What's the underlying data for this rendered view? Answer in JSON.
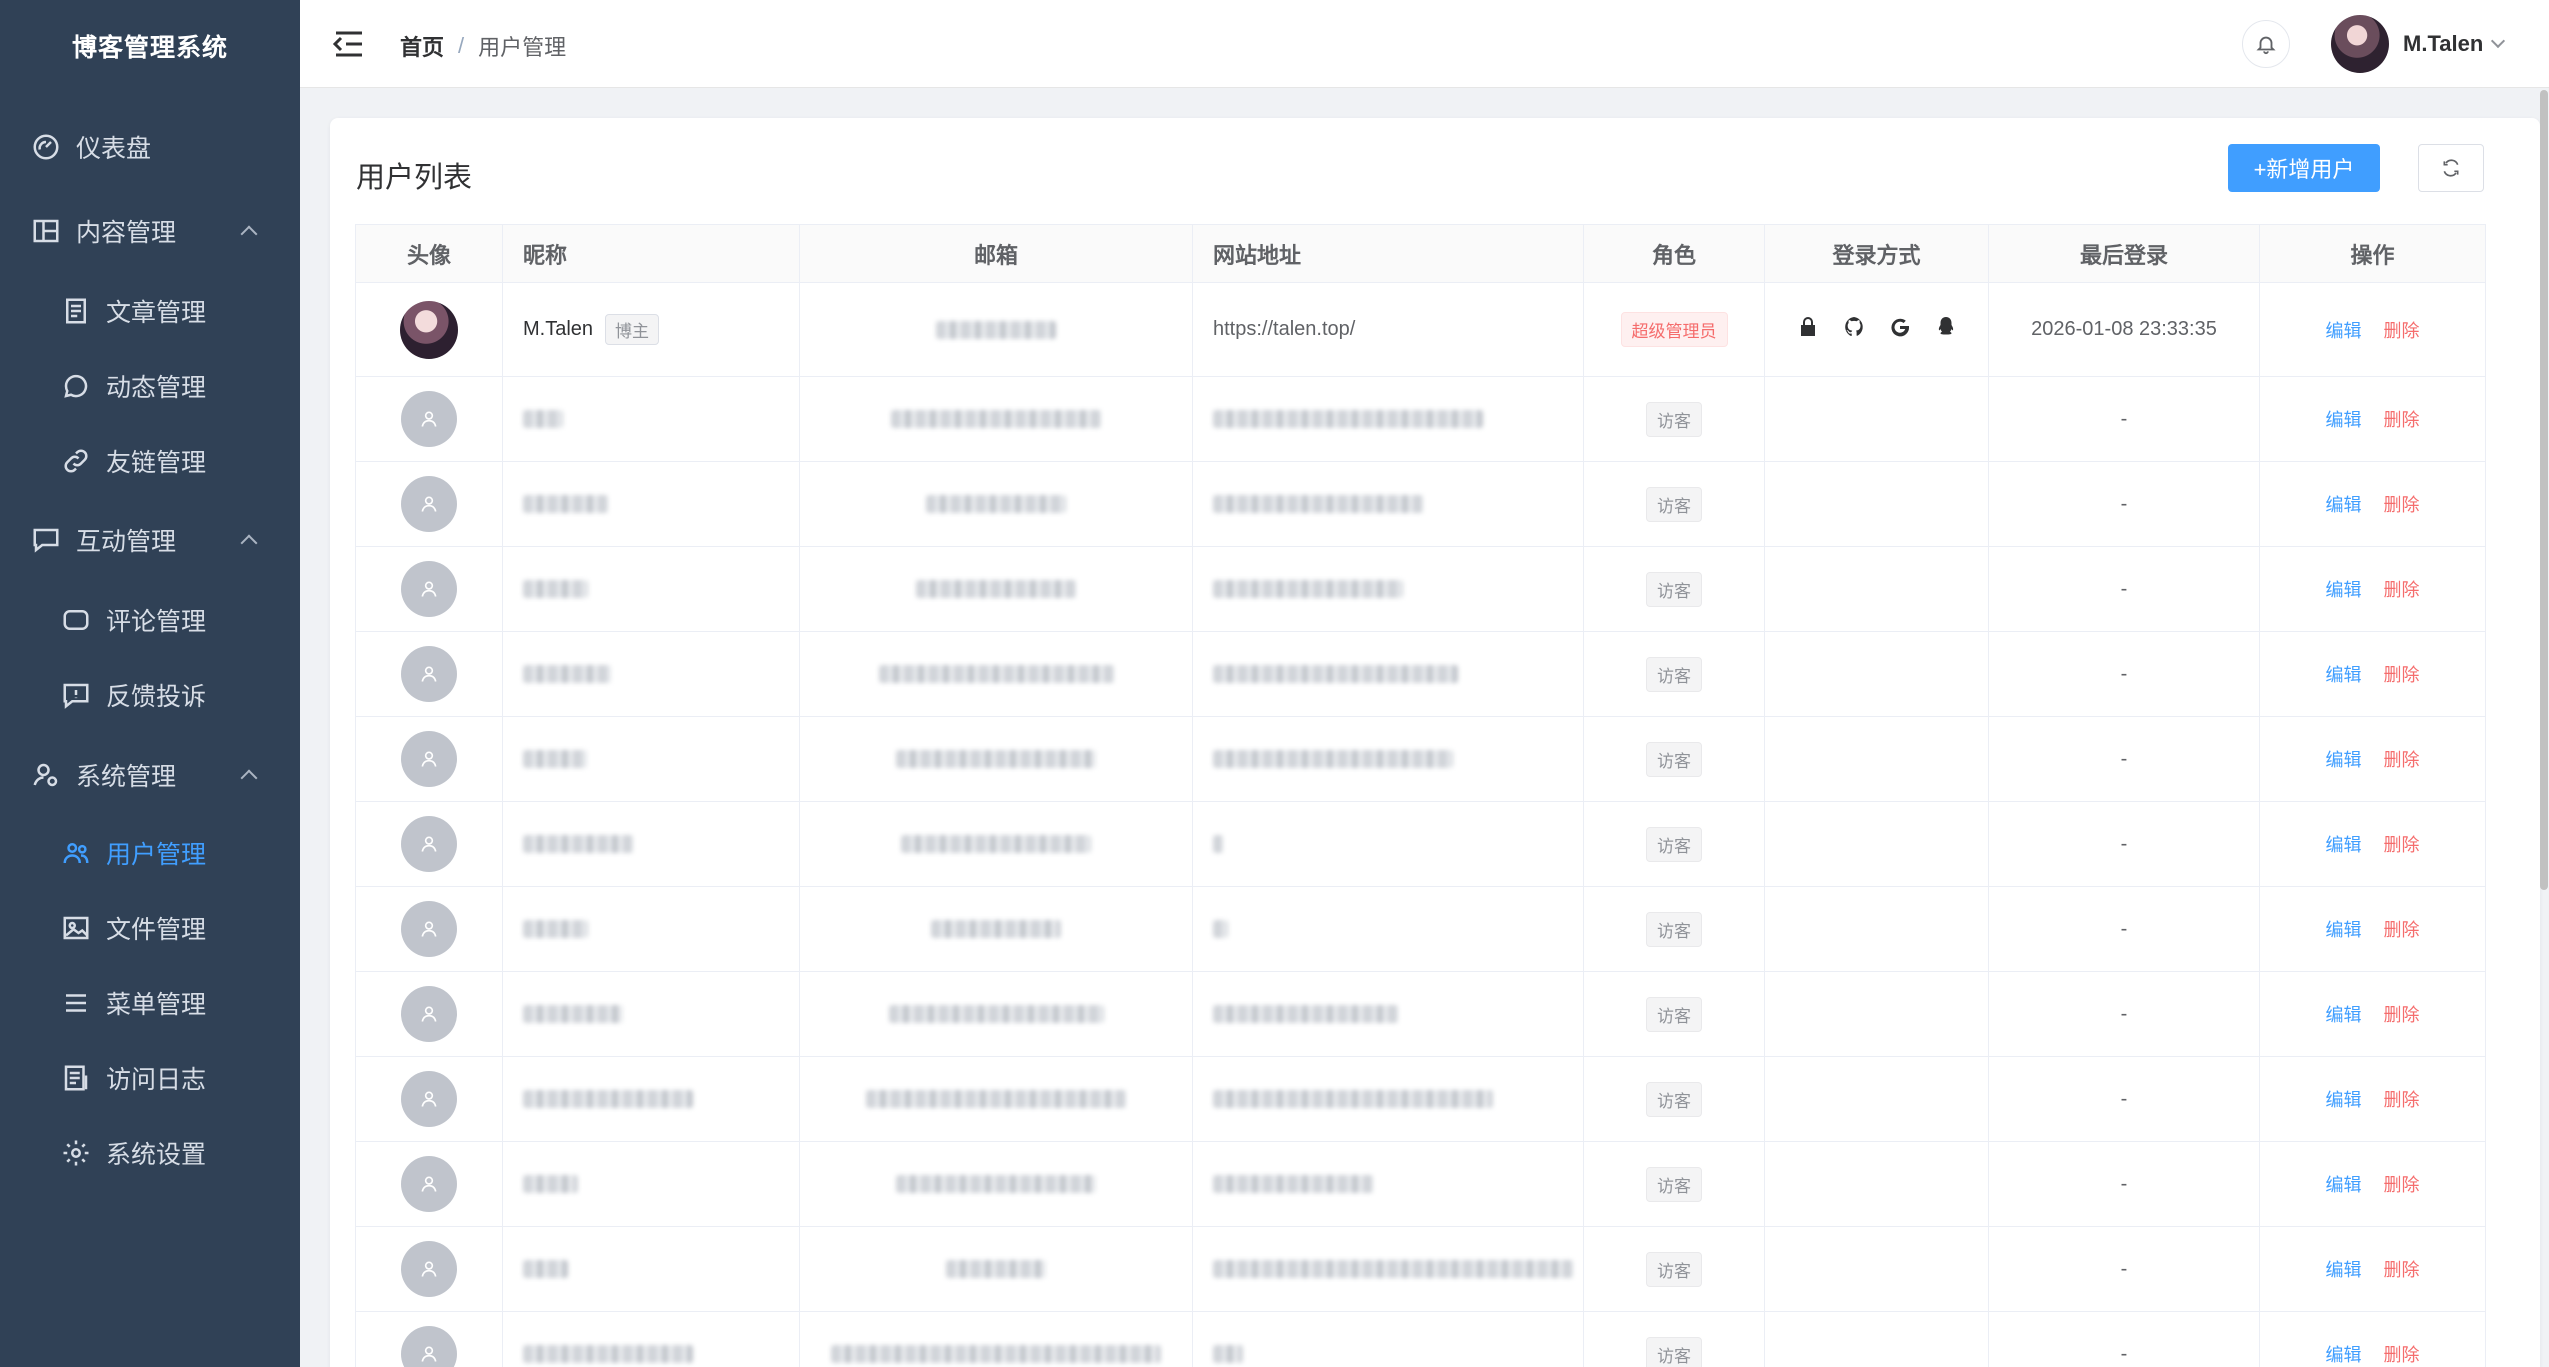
{
  "app": {
    "title": "博客管理系统"
  },
  "menu": {
    "dashboard": "仪表盘",
    "content": "内容管理",
    "articles": "文章管理",
    "moments": "动态管理",
    "friends": "友链管理",
    "interaction": "互动管理",
    "comments": "评论管理",
    "feedback": "反馈投诉",
    "system": "系统管理",
    "users": "用户管理",
    "files": "文件管理",
    "menus": "菜单管理",
    "logs": "访问日志",
    "settings": "系统设置"
  },
  "header": {
    "breadcrumb_home": "首页",
    "breadcrumb_sep": "/",
    "breadcrumb_current": "用户管理",
    "username": "M.Talen"
  },
  "page": {
    "title": "用户列表",
    "add_button": "+新增用户"
  },
  "table": {
    "columns": {
      "avatar": "头像",
      "nickname": "昵称",
      "email": "邮箱",
      "website": "网站地址",
      "role": "角色",
      "login_method": "登录方式",
      "last_login": "最后登录",
      "actions": "操作"
    },
    "first_row": {
      "nickname": "M.Talen",
      "owner_tag": "博主",
      "website": "https://talen.top/",
      "role": "超级管理员",
      "login_icons": [
        "lock-icon",
        "github-icon",
        "google-icon",
        "qq-icon"
      ],
      "last_login": "2026-01-08 23:33:35",
      "edit": "编辑",
      "delete": "删除"
    },
    "guest_rows": [
      {
        "role": "访客",
        "last_login": "-",
        "edit": "编辑",
        "delete": "删除"
      },
      {
        "role": "访客",
        "last_login": "-",
        "edit": "编辑",
        "delete": "删除"
      },
      {
        "role": "访客",
        "last_login": "-",
        "edit": "编辑",
        "delete": "删除"
      },
      {
        "role": "访客",
        "last_login": "-",
        "edit": "编辑",
        "delete": "删除"
      },
      {
        "role": "访客",
        "last_login": "-",
        "edit": "编辑",
        "delete": "删除"
      },
      {
        "role": "访客",
        "last_login": "-",
        "edit": "编辑",
        "delete": "删除"
      },
      {
        "role": "访客",
        "last_login": "-",
        "edit": "编辑",
        "delete": "删除"
      },
      {
        "role": "访客",
        "last_login": "-",
        "edit": "编辑",
        "delete": "删除"
      },
      {
        "role": "访客",
        "last_login": "-",
        "edit": "编辑",
        "delete": "删除"
      },
      {
        "role": "访客",
        "last_login": "-",
        "edit": "编辑",
        "delete": "删除"
      },
      {
        "role": "访客",
        "last_login": "-",
        "edit": "编辑",
        "delete": "删除"
      },
      {
        "role": "访客",
        "last_login": "-",
        "edit": "编辑",
        "delete": "删除"
      }
    ]
  },
  "colors": {
    "sidebar_bg": "#304156",
    "accent": "#409eff",
    "danger": "#f56c6c"
  }
}
